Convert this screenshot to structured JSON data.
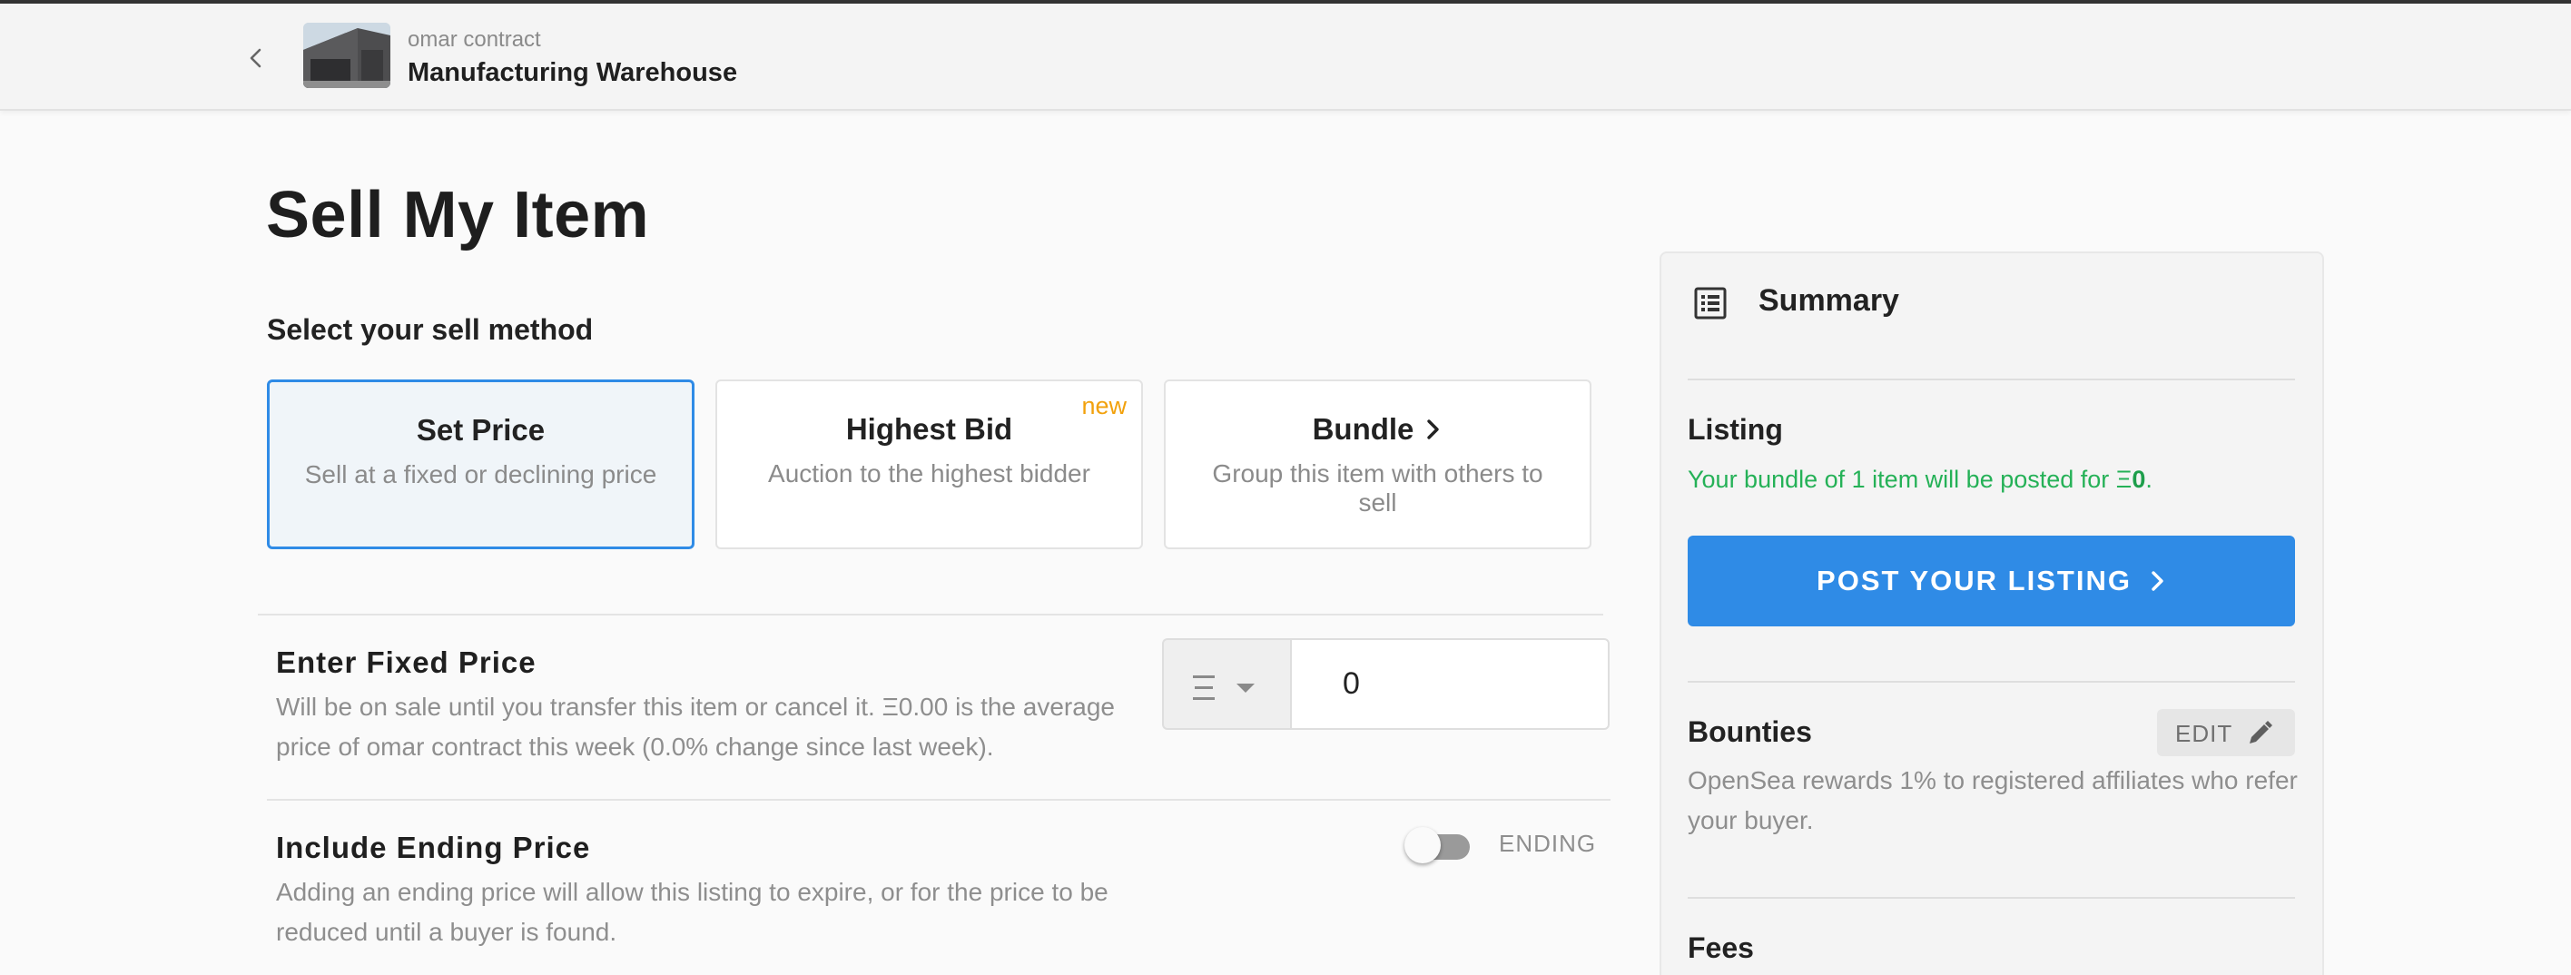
{
  "header": {
    "collection_name": "omar contract",
    "item_name": "Manufacturing Warehouse"
  },
  "page": {
    "title": "Sell My Item",
    "sell_method_label": "Select your sell method"
  },
  "methods": [
    {
      "title": "Set Price",
      "description": "Sell at a fixed or declining price",
      "selected": true
    },
    {
      "title": "Highest Bid",
      "description": "Auction to the highest bidder",
      "badge": "new"
    },
    {
      "title": "Bundle",
      "description": "Group this item with others to sell"
    }
  ],
  "fixed_price": {
    "title": "Enter Fixed Price",
    "description": "Will be on sale until you transfer this item or cancel it. Ξ0.00 is the average price of omar contract this week (0.0% change since last week).",
    "currency_icon": "ethereum-icon",
    "value": "0"
  },
  "ending_price": {
    "title": "Include Ending Price",
    "description": "Adding an ending price will allow this listing to expire, or for the price to be reduced until a buyer is found.",
    "toggle_label": "ENDING",
    "enabled": false
  },
  "summary": {
    "title": "Summary",
    "listing_heading": "Listing",
    "listing_text_prefix": "Your bundle of 1 item will be posted for ",
    "listing_currency": "Ξ",
    "listing_amount": "0",
    "listing_text_suffix": ".",
    "post_button": "POST YOUR LISTING",
    "bounties_heading": "Bounties",
    "edit_label": "EDIT",
    "bounties_text": "OpenSea rewards 1% to registered affiliates who refer your buyer.",
    "fees_heading": "Fees"
  },
  "colors": {
    "accent_blue": "#2f8be6",
    "new_badge": "#f2a10c",
    "success_green": "#25b157"
  }
}
